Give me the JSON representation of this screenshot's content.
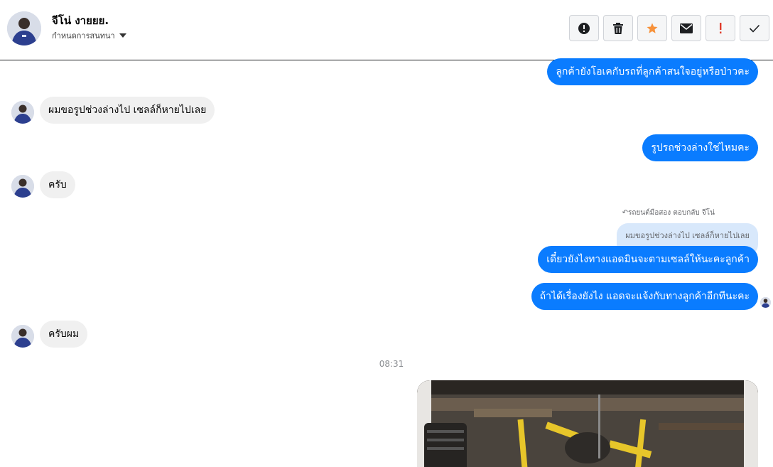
{
  "header": {
    "contact_name": "จีโน่ งายยย.",
    "settings_label": "กำหนดการสนทนา"
  },
  "actions": [
    {
      "name": "spam-button",
      "icon": "alert-circle-icon"
    },
    {
      "name": "delete-button",
      "icon": "trash-icon"
    },
    {
      "name": "star-button",
      "icon": "star-icon",
      "color": "#f7923b"
    },
    {
      "name": "mark-unread-button",
      "icon": "envelope-icon"
    },
    {
      "name": "important-button",
      "icon": "exclamation-icon",
      "color": "#e03b2a"
    },
    {
      "name": "done-button",
      "icon": "check-icon"
    }
  ],
  "messages": {
    "m1": "ลูกค้ายังโอเคกับรถที่ลูกค้าสนใจอยู่หรือป่าวคะ",
    "m2": "ผมขอรูปช่วงล่างไป เซลล์ก็หายไปเลย",
    "m3": "รูปรถช่วงล่างใช่ไหมคะ",
    "m4": "ครับ",
    "reply_note": "รถยนต์มือสอง ตอบกลับ จีโน่",
    "quoted": "ผมขอรูปช่วงล่างไป เซลล์ก็หายไปเลย",
    "m5": "เดี๋ยวยังไงทางแอดมินจะตามเซลล์ให้นะคะลูกค้า",
    "m6": "ถ้าได้เรื่องยังไง แอดจะแจ้งกับทางลูกค้าอีกทีนะคะ",
    "m7": "ครับผม"
  },
  "timestamp": "08:31",
  "colors": {
    "outgoing": "#0a7cff",
    "incoming": "#f0f0f0"
  }
}
